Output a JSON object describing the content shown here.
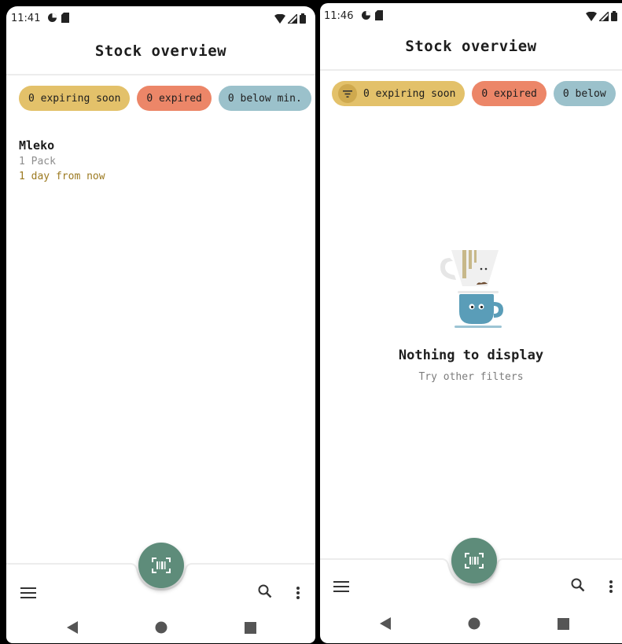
{
  "left": {
    "status": {
      "time": "11:41"
    },
    "title": "Stock overview",
    "chips": [
      {
        "label": "0 expiring soon",
        "color": "#e3c16a"
      },
      {
        "label": "0 expired",
        "color": "#ec8668"
      },
      {
        "label": "0 below min.",
        "color": "#9bc1cb"
      }
    ],
    "item": {
      "name": "Mleko",
      "amount": "1 Pack",
      "due": "1 day from now"
    }
  },
  "right": {
    "status": {
      "time": "11:46"
    },
    "title": "Stock overview",
    "chips": [
      {
        "label": "0 expiring soon",
        "color": "#e3c16a"
      },
      {
        "label": "0 expired",
        "color": "#ec8668"
      },
      {
        "label": "0 below",
        "color": "#9bc1cb"
      }
    ],
    "empty": {
      "title": "Nothing to display",
      "subtitle": "Try other filters"
    }
  },
  "icons": {
    "menu": "menu-icon",
    "search": "search-icon",
    "more": "more-vert-icon",
    "scan": "barcode-scan-icon",
    "filter": "filter-icon",
    "back": "nav-back-icon",
    "home": "nav-home-icon",
    "recents": "nav-recents-icon"
  },
  "colors": {
    "fab": "#5e8c7a",
    "due_text": "#9c7a21"
  }
}
